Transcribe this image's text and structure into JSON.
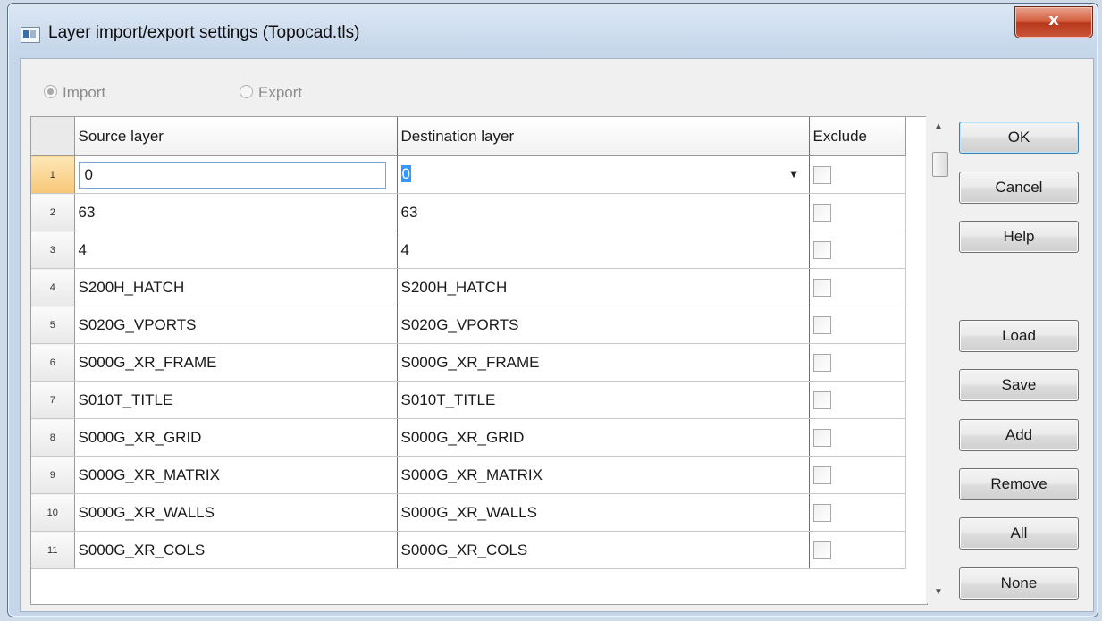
{
  "window": {
    "title": "Layer import/export settings (Topocad.tls)",
    "close_label": "x"
  },
  "mode": {
    "import_label": "Import",
    "export_label": "Export",
    "selected": "Import"
  },
  "grid": {
    "columns": [
      "Source layer",
      "Destination layer",
      "Exclude"
    ],
    "rows": [
      {
        "num": "1",
        "source": "0",
        "destination": "0",
        "exclude": false
      },
      {
        "num": "2",
        "source": "63",
        "destination": "63",
        "exclude": false
      },
      {
        "num": "3",
        "source": "4",
        "destination": "4",
        "exclude": false
      },
      {
        "num": "4",
        "source": "S200H_HATCH",
        "destination": "S200H_HATCH",
        "exclude": false
      },
      {
        "num": "5",
        "source": "S020G_VPORTS",
        "destination": "S020G_VPORTS",
        "exclude": false
      },
      {
        "num": "6",
        "source": "S000G_XR_FRAME",
        "destination": "S000G_XR_FRAME",
        "exclude": false
      },
      {
        "num": "7",
        "source": "S010T_TITLE",
        "destination": "S010T_TITLE",
        "exclude": false
      },
      {
        "num": "8",
        "source": "S000G_XR_GRID",
        "destination": "S000G_XR_GRID",
        "exclude": false
      },
      {
        "num": "9",
        "source": "S000G_XR_MATRIX",
        "destination": "S000G_XR_MATRIX",
        "exclude": false
      },
      {
        "num": "10",
        "source": "S000G_XR_WALLS",
        "destination": "S000G_XR_WALLS",
        "exclude": false
      },
      {
        "num": "11",
        "source": "S000G_XR_COLS",
        "destination": "S000G_XR_COLS",
        "exclude": false
      }
    ]
  },
  "buttons": {
    "ok": "OK",
    "cancel": "Cancel",
    "help": "Help",
    "load": "Load",
    "save": "Save",
    "add": "Add",
    "remove": "Remove",
    "all": "All",
    "none": "None"
  },
  "icons": {
    "scroll_up": "scroll-up-arrow-icon",
    "scroll_down": "scroll-down-arrow-icon",
    "dropdown": "dropdown-arrow-icon"
  },
  "colors": {
    "selection": "#3399ff",
    "active_row_header": "#f8c778",
    "close_button": "#c9573a"
  }
}
